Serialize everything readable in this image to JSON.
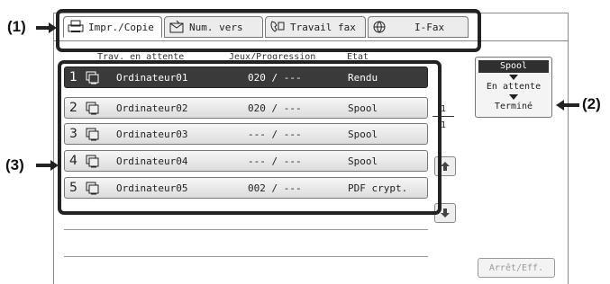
{
  "tabs": [
    {
      "label": "Impr./Copie",
      "icon": "print-copy-icon",
      "active": true
    },
    {
      "label": "Num. vers",
      "icon": "scan-icon",
      "active": false
    },
    {
      "label": "Travail fax",
      "icon": "fax-icon",
      "active": false
    },
    {
      "label": "I-Fax",
      "icon": "internet-fax-icon",
      "active": false
    }
  ],
  "columns": {
    "queue": "Trav. en attente",
    "progress": "Jeux/Progression",
    "status": "Etat"
  },
  "jobs": [
    {
      "num": "1",
      "name": "Ordinateur01",
      "progress": "020 / ---",
      "status": "Rendu",
      "selected": true
    },
    {
      "num": "2",
      "name": "Ordinateur02",
      "progress": "020 / ---",
      "status": "Spool",
      "selected": false
    },
    {
      "num": "3",
      "name": "Ordinateur03",
      "progress": "--- / ---",
      "status": "Spool",
      "selected": false
    },
    {
      "num": "4",
      "name": "Ordinateur04",
      "progress": "--- / ---",
      "status": "Spool",
      "selected": false
    },
    {
      "num": "5",
      "name": "Ordinateur05",
      "progress": "002 / ---",
      "status": "PDF crypt.",
      "selected": false
    }
  ],
  "status_selector": {
    "options": [
      "Spool",
      "En attente",
      "Terminé"
    ],
    "selected": "Spool"
  },
  "pagination": {
    "current": "1",
    "total": "1"
  },
  "stop_button": "Arrêt/Eff.",
  "callouts": {
    "tabs": "(1)",
    "status": "(2)",
    "list": "(3)"
  },
  "colors": {
    "selected_row": "#3a3a3a",
    "callout": "#222222"
  }
}
